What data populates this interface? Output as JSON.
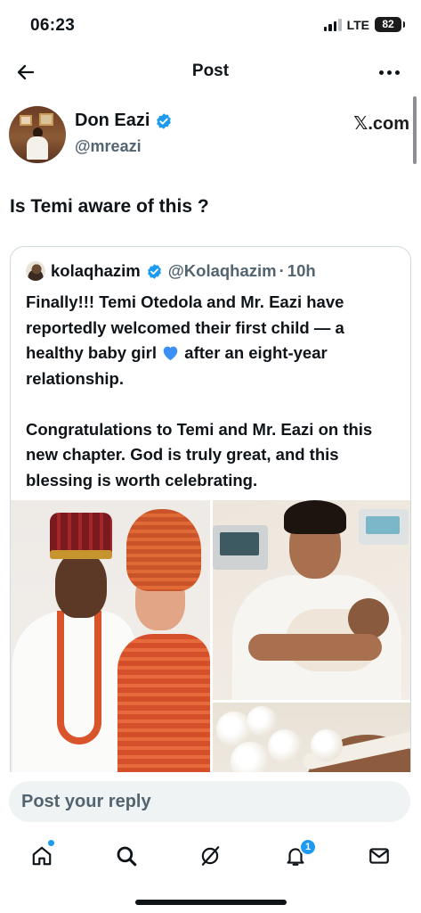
{
  "status_bar": {
    "time": "06:23",
    "network": "LTE",
    "battery": "82"
  },
  "nav": {
    "title": "Post",
    "back_icon": "arrow-left-icon",
    "more_icon": "more-horizontal-icon"
  },
  "author": {
    "name": "Don Eazi",
    "handle": "@mreazi",
    "source": "𝕏.com",
    "verified": true
  },
  "post": {
    "text": "Is Temi aware of this ?"
  },
  "quoted_post": {
    "name": "kolaqhazim",
    "handle": "@Kolaqhazim",
    "separator": "·",
    "time": "10h",
    "paragraph_1_a": "Finally!!! Temi Otedola and Mr. Eazi have reportedly welcomed their first child — a healthy baby girl",
    "paragraph_1_b": "after an eight-year relationship.",
    "paragraph_2": "Congratulations to Temi and Mr. Eazi on this new chapter. God is truly great, and this blessing is worth celebrating.",
    "media_count": 3
  },
  "reply": {
    "placeholder": "Post your reply"
  },
  "tab_bar": {
    "items": [
      {
        "icon": "home-icon",
        "has_dot": true
      },
      {
        "icon": "search-icon"
      },
      {
        "icon": "grok-icon"
      },
      {
        "icon": "bell-icon",
        "badge": "1"
      },
      {
        "icon": "mail-icon"
      }
    ]
  },
  "colors": {
    "accent": "#1d9bf0",
    "secondary_text": "#536471",
    "border": "#cfd9de",
    "reply_bg": "#eff3f4"
  }
}
